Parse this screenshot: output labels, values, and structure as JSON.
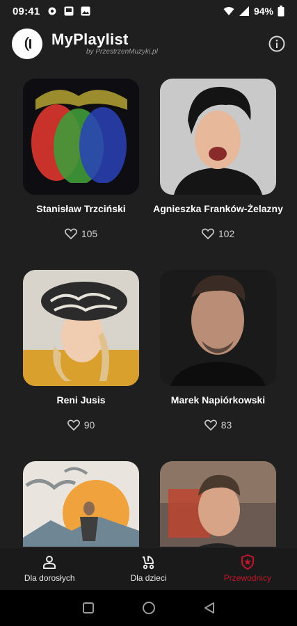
{
  "status": {
    "time": "09:41",
    "battery": "94%"
  },
  "header": {
    "title": "MyPlaylist",
    "subtitle": "by PrzestrzenMuzyki.pl"
  },
  "artists": [
    {
      "name": "Stanisław Trzciński",
      "likes": "105"
    },
    {
      "name": "Agnieszka Franków-Żelazny",
      "likes": "102"
    },
    {
      "name": "Reni Jusis",
      "likes": "90"
    },
    {
      "name": "Marek Napiórkowski",
      "likes": "83"
    },
    {
      "name": "",
      "likes": ""
    },
    {
      "name": "",
      "likes": ""
    }
  ],
  "nav": {
    "adults": "Dla dorosłych",
    "kids": "Dla dzieci",
    "guides": "Przewodnicy",
    "active": "guides"
  },
  "colors": {
    "accent": "#c4162a",
    "background": "#1f1f1f"
  }
}
